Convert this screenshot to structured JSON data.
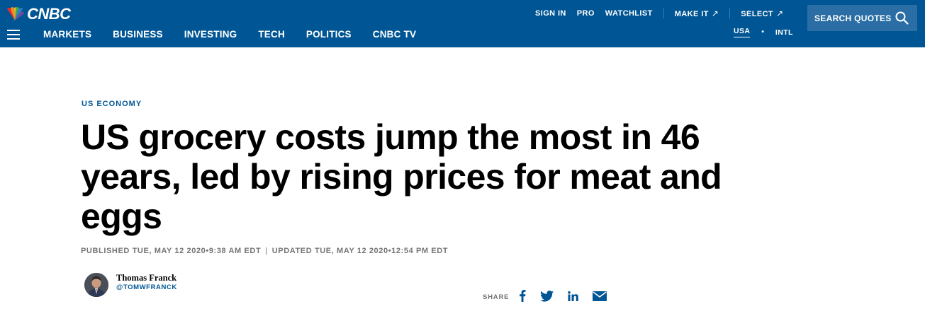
{
  "header": {
    "logo_text": "CNBC",
    "nav": [
      "MARKETS",
      "BUSINESS",
      "INVESTING",
      "TECH",
      "POLITICS",
      "CNBC TV"
    ],
    "utility": {
      "sign_in": "SIGN IN",
      "pro": "PRO",
      "watchlist": "WATCHLIST",
      "make_it": "MAKE IT",
      "select": "SELECT"
    },
    "region": {
      "usa": "USA",
      "separator": "•",
      "intl": "INTL"
    },
    "search_label": "SEARCH QUOTES",
    "colors": {
      "bar": "#005594",
      "search_bg": "#2a6ea5"
    }
  },
  "article": {
    "kicker": "US ECONOMY",
    "headline": "US grocery costs jump the most in 46 years, led by rising prices for meat and eggs",
    "published": "PUBLISHED TUE, MAY 12 2020•9:38 AM EDT",
    "timestamp_separator": "|",
    "updated": "UPDATED TUE, MAY 12 2020•12:54 PM EDT",
    "author": {
      "name": "Thomas Franck",
      "handle": "@TOMWFRANCK"
    },
    "share_label": "SHARE",
    "share_icons": [
      "facebook-icon",
      "twitter-icon",
      "linkedin-icon",
      "email-icon"
    ]
  }
}
